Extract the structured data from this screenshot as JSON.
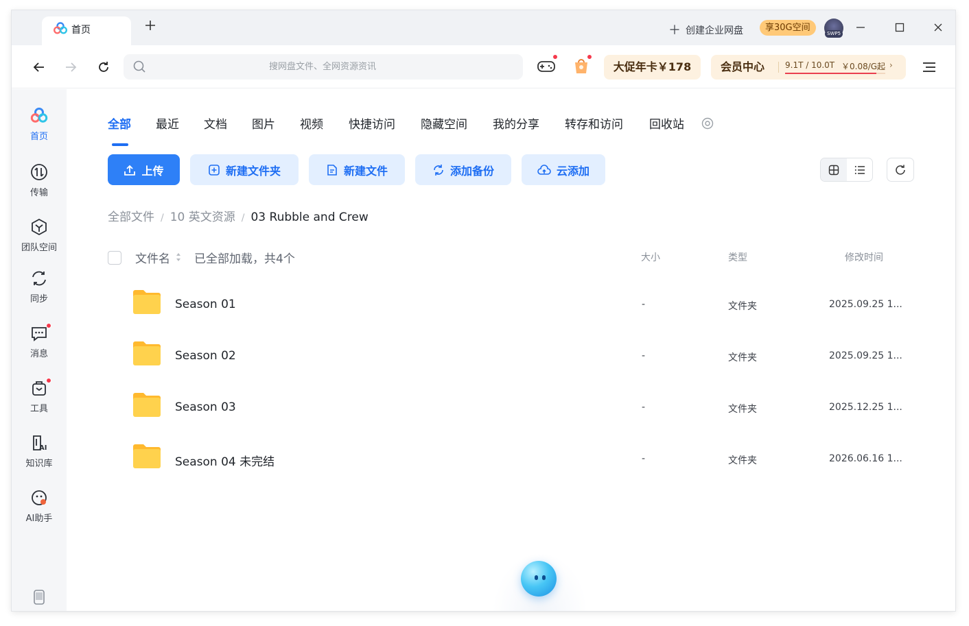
{
  "titlebar": {
    "tab_label": "首页",
    "create_enterprise": "创建企业网盘",
    "space_badge": "享30G空间",
    "avatar_tag": "SWP5"
  },
  "navbar": {
    "search_placeholder": "搜网盘文件、全网资源资讯",
    "promo_card": "大促年卡￥178",
    "vip_center": {
      "title": "会员中心",
      "quota": "9.1T / 10.0T",
      "price": "￥0.08/G起",
      "quota_used_fraction": 0.91
    }
  },
  "sidebar": {
    "items": [
      {
        "label": "首页",
        "icon": "cloud-logo-icon",
        "active": true
      },
      {
        "label": "传输",
        "icon": "transfer-icon",
        "active": false
      },
      {
        "label": "团队空间",
        "icon": "team-space-icon",
        "active": false
      },
      {
        "label": "同步",
        "icon": "sync-icon",
        "active": false
      },
      {
        "label": "消息",
        "icon": "message-icon",
        "active": false,
        "badge": true
      },
      {
        "label": "工具",
        "icon": "tools-icon",
        "active": false,
        "badge": true
      },
      {
        "label": "知识库",
        "icon": "knowledge-base-icon",
        "active": false
      },
      {
        "label": "AI助手",
        "icon": "ai-assistant-icon",
        "active": false
      }
    ]
  },
  "category_tabs": [
    "全部",
    "最近",
    "文档",
    "图片",
    "视频",
    "快捷访问",
    "隐藏空间",
    "我的分享",
    "转存和访问",
    "回收站"
  ],
  "actions": {
    "upload": "上传",
    "new_folder": "新建文件夹",
    "new_file": "新建文件",
    "add_backup": "添加备份",
    "cloud_add": "云添加"
  },
  "breadcrumb": [
    "全部文件",
    "10 英文资源",
    "03 Rubble and Crew"
  ],
  "table": {
    "headers": {
      "name": "文件名",
      "size": "大小",
      "type": "类型",
      "modified": "修改时间"
    },
    "load_status": "已全部加载，共4个",
    "rows": [
      {
        "name": "Season 01",
        "size": "-",
        "type": "文件夹",
        "modified": "2025.09.25 1..."
      },
      {
        "name": "Season 02",
        "size": "-",
        "type": "文件夹",
        "modified": "2025.09.25 1..."
      },
      {
        "name": "Season 03",
        "size": "-",
        "type": "文件夹",
        "modified": "2025.12.25 1..."
      },
      {
        "name": "Season 04 未完结",
        "size": "-",
        "type": "文件夹",
        "modified": "2026.06.16 1..."
      }
    ]
  },
  "colors": {
    "accent": "#1e6ef3",
    "primary_button": "#2e80f7",
    "secondary_button_bg": "#e3efff",
    "badge_red": "#f5394c",
    "folder_yellow": "#ffd24d",
    "vip_bg": "#fdf1e0"
  }
}
